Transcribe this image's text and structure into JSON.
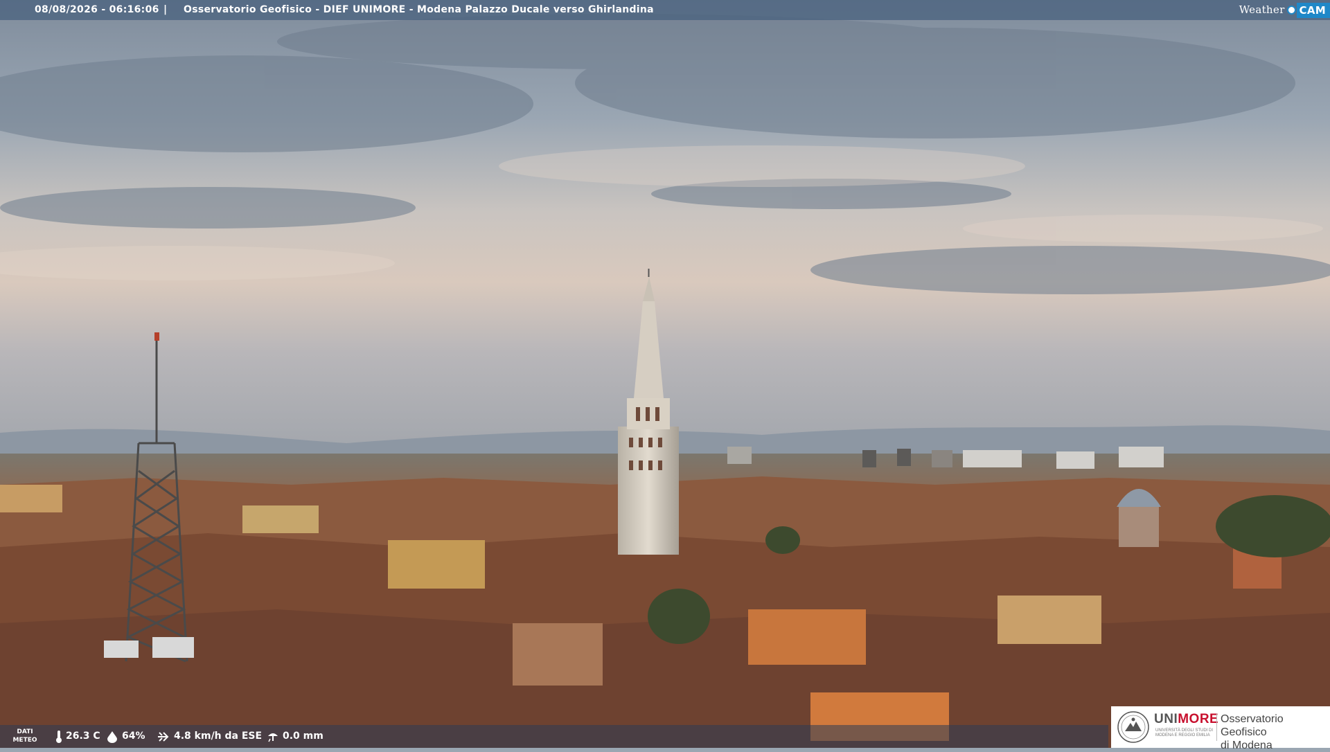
{
  "overlay": {
    "timestamp": "08/08/2026 - 06:16:06",
    "separator": "|",
    "location": "Osservatorio Geofisico - DIEF UNIMORE - Modena Palazzo Ducale verso Ghirlandina",
    "brand_weather": "Weather",
    "brand_cam": "CAM"
  },
  "meteo": {
    "label_line1": "DATI",
    "label_line2": "METEO",
    "temperature": "26.3 C",
    "humidity": "64%",
    "wind": "4.8 km/h da ESE",
    "rain": "0.0 mm"
  },
  "logo": {
    "university_prefix": "UNI",
    "university_suffix": "MORE",
    "university_subtitle": "UNIVERSITÀ DEGLI STUDI DI MODENA E REGGIO EMILIA",
    "observatory_line1": "Osservatorio Geofisico",
    "observatory_line2": "di Modena"
  },
  "colors": {
    "overlay_bar": "#465f7d",
    "brand_blue": "#1f88c8",
    "unimore_red": "#c8102e",
    "roof_terracotta": "#9a5a3c",
    "sky_top": "#8e9bab",
    "sky_horizon": "#d8c7bb"
  },
  "icons": [
    "thermometer-icon",
    "humidity-drop-icon",
    "wind-icon",
    "rain-icon",
    "unimore-seal-icon"
  ]
}
